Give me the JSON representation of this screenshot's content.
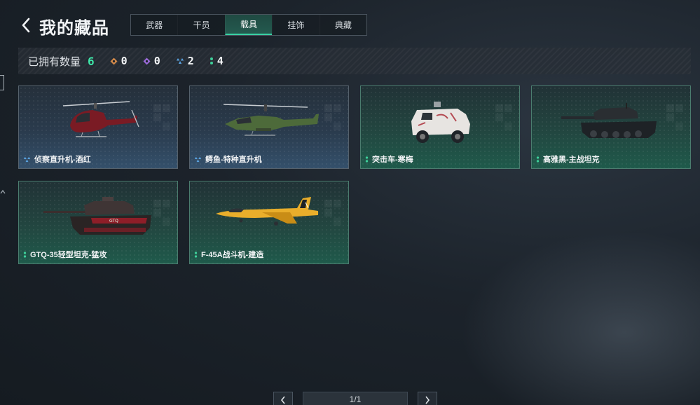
{
  "header": {
    "title": "我的藏品"
  },
  "tabs": [
    {
      "label": "武器",
      "active": false
    },
    {
      "label": "干员",
      "active": false
    },
    {
      "label": "载具",
      "active": true
    },
    {
      "label": "挂饰",
      "active": false
    },
    {
      "label": "典藏",
      "active": false
    }
  ],
  "owned": {
    "label": "已拥有数量",
    "total": "6",
    "rarities": [
      {
        "icon": "orange-diamond-icon",
        "color": "#d1894a",
        "count": "0"
      },
      {
        "icon": "purple-diamond-icon",
        "color": "#9a6ad8",
        "count": "0"
      },
      {
        "icon": "blue-chevron-icon",
        "color": "#5aa2df",
        "count": "2"
      },
      {
        "icon": "green-dots-icon",
        "color": "#3ecf9a",
        "count": "4"
      }
    ]
  },
  "items": [
    {
      "name": "侦察直升机-酒红",
      "rarity": "blue",
      "art": "scout-helicopter"
    },
    {
      "name": "鳄鱼-特种直升机",
      "rarity": "blue",
      "art": "attack-helicopter"
    },
    {
      "name": "突击车-寒梅",
      "rarity": "green",
      "art": "assault-vehicle"
    },
    {
      "name": "高雅黑-主战坦克",
      "rarity": "green",
      "art": "main-battle-tank"
    },
    {
      "name": "GTQ-35轻型坦克-猛攻",
      "rarity": "green",
      "art": "light-tank"
    },
    {
      "name": "F-45A战斗机-建造",
      "rarity": "green",
      "art": "fighter-jet"
    }
  ],
  "pagination": {
    "page_text": "1/1"
  },
  "colors": {
    "accent": "#3ee6a8",
    "rarity_blue": "#5aa2df",
    "rarity_green": "#3ecf9a"
  }
}
